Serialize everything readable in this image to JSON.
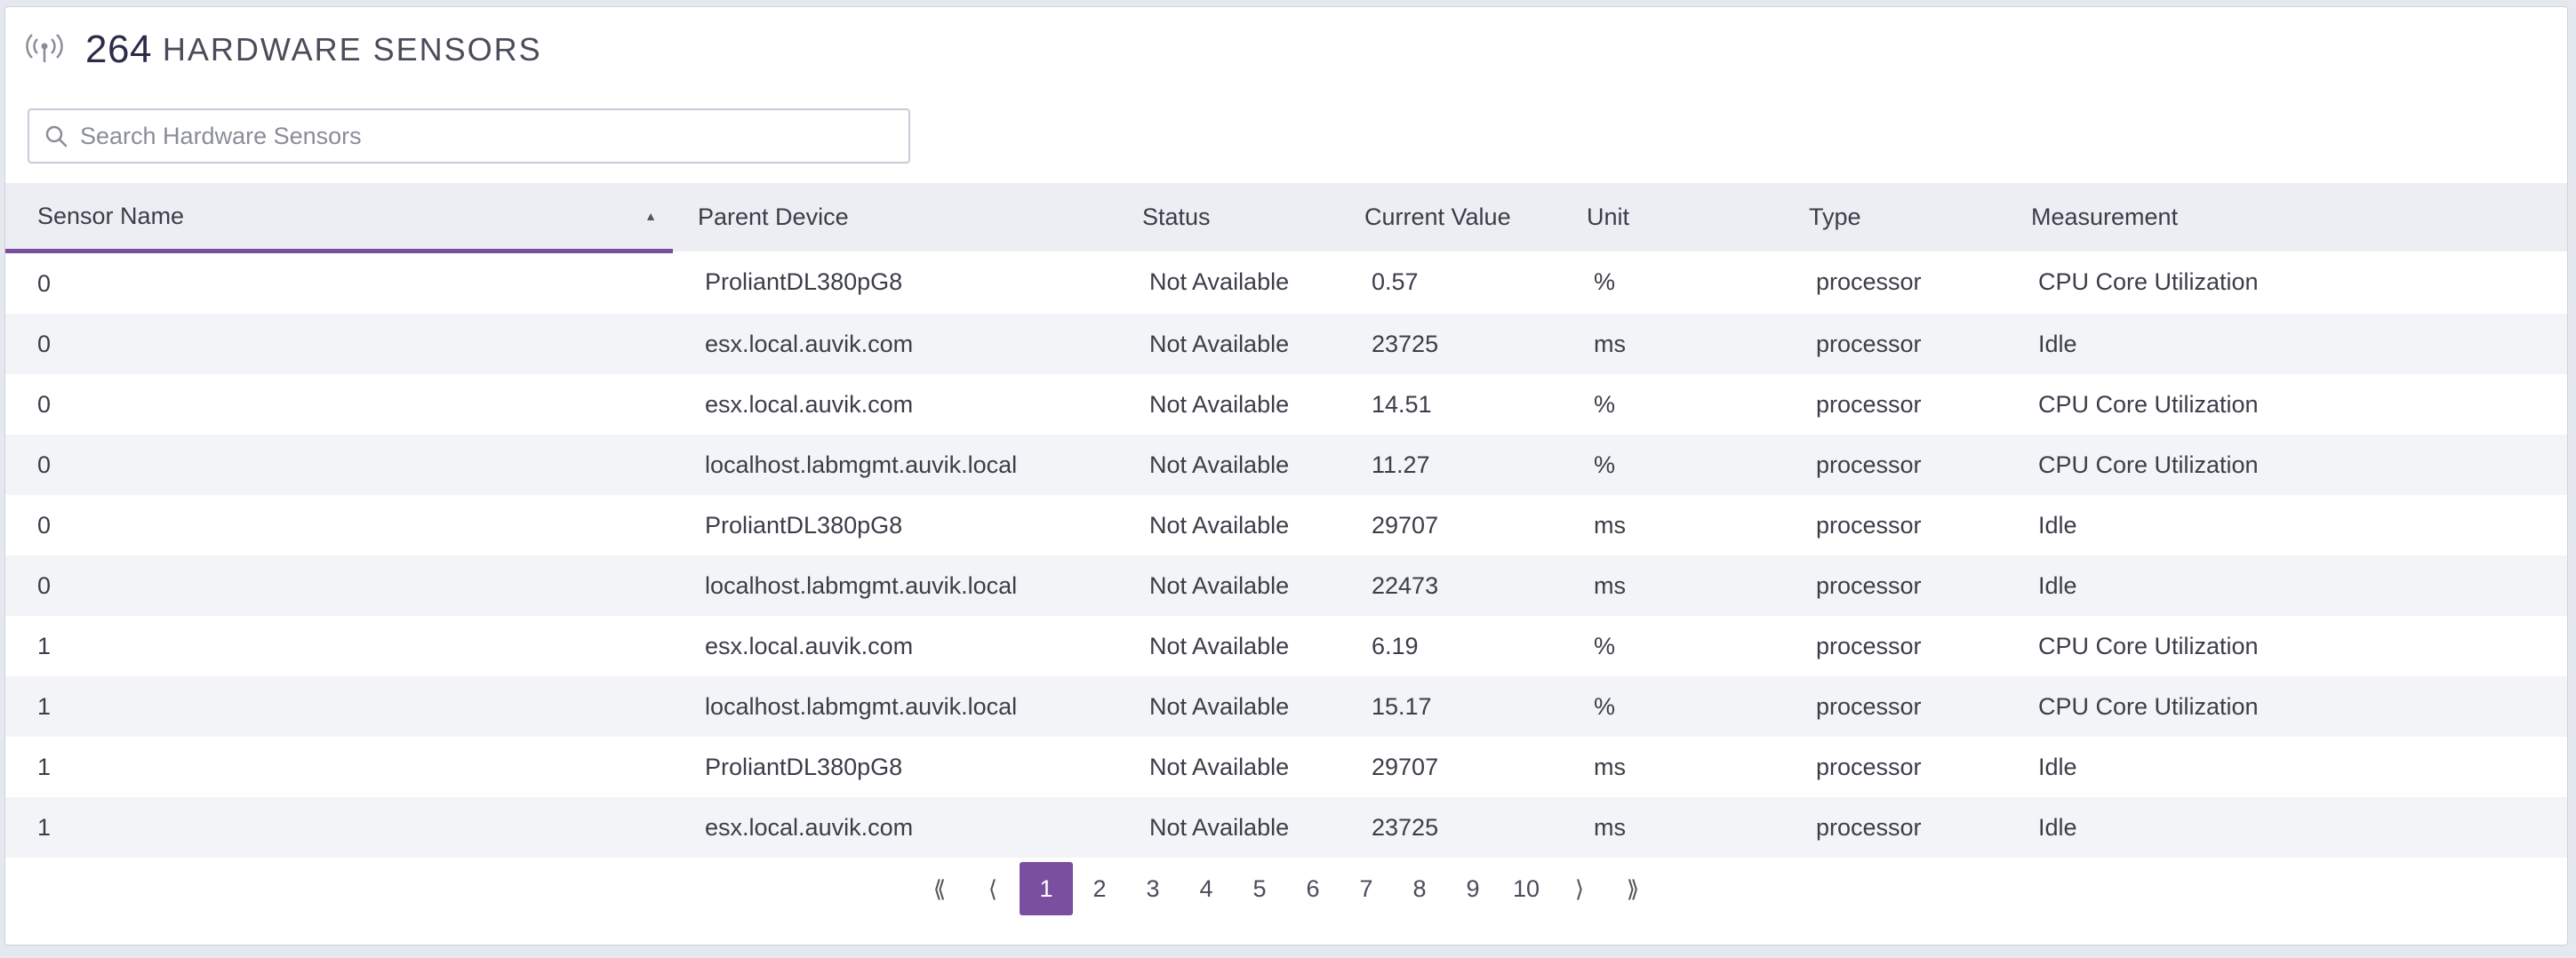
{
  "header": {
    "count": "264",
    "title": "HARDWARE SENSORS",
    "icon": "broadcast-antenna-icon"
  },
  "search": {
    "placeholder": "Search Hardware Sensors",
    "value": "",
    "icon": "search-icon"
  },
  "table": {
    "columns": [
      "Sensor Name",
      "Parent Device",
      "Status",
      "Current Value",
      "Unit",
      "Type",
      "Measurement"
    ],
    "sorted_column": "Sensor Name",
    "sort_direction": "ascending",
    "rows": [
      [
        "0",
        "ProliantDL380pG8",
        "Not Available",
        "0.57",
        "%",
        "processor",
        "CPU Core Utilization"
      ],
      [
        "0",
        "esx.local.auvik.com",
        "Not Available",
        "23725",
        "ms",
        "processor",
        "Idle"
      ],
      [
        "0",
        "esx.local.auvik.com",
        "Not Available",
        "14.51",
        "%",
        "processor",
        "CPU Core Utilization"
      ],
      [
        "0",
        "localhost.labmgmt.auvik.local",
        "Not Available",
        "11.27",
        "%",
        "processor",
        "CPU Core Utilization"
      ],
      [
        "0",
        "ProliantDL380pG8",
        "Not Available",
        "29707",
        "ms",
        "processor",
        "Idle"
      ],
      [
        "0",
        "localhost.labmgmt.auvik.local",
        "Not Available",
        "22473",
        "ms",
        "processor",
        "Idle"
      ],
      [
        "1",
        "esx.local.auvik.com",
        "Not Available",
        "6.19",
        "%",
        "processor",
        "CPU Core Utilization"
      ],
      [
        "1",
        "localhost.labmgmt.auvik.local",
        "Not Available",
        "15.17",
        "%",
        "processor",
        "CPU Core Utilization"
      ],
      [
        "1",
        "ProliantDL380pG8",
        "Not Available",
        "29707",
        "ms",
        "processor",
        "Idle"
      ],
      [
        "1",
        "esx.local.auvik.com",
        "Not Available",
        "23725",
        "ms",
        "processor",
        "Idle"
      ]
    ]
  },
  "pagination": {
    "first": "⟪",
    "prev": "⟨",
    "pages": [
      "1",
      "2",
      "3",
      "4",
      "5",
      "6",
      "7",
      "8",
      "9",
      "10"
    ],
    "current": "1",
    "next": "⟩",
    "last": "⟫"
  },
  "colors": {
    "accent": "#7b4fa0",
    "header_bg": "#eceef3",
    "stripe": "#f3f4f7"
  }
}
